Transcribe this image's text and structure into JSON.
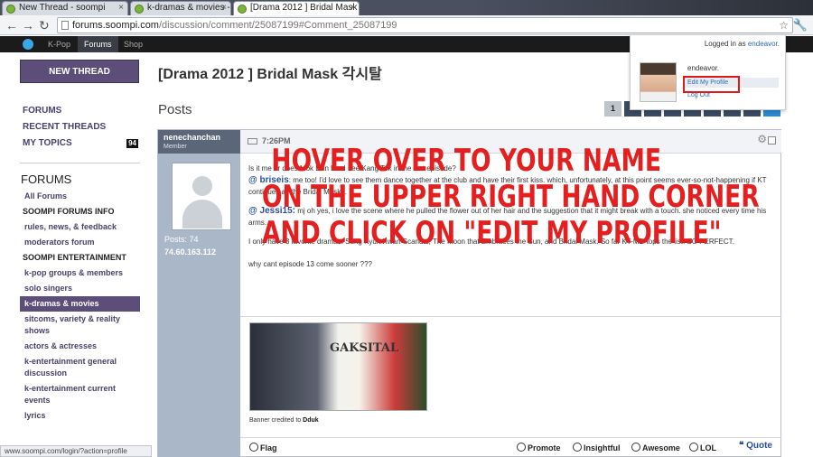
{
  "browser": {
    "tabs": [
      {
        "title": "New Thread - soompi",
        "active": false
      },
      {
        "title": "k-dramas & movies - soom",
        "active": false
      },
      {
        "title": "[Drama 2012 ] Bridal Mask",
        "active": true
      }
    ],
    "url_domain": "forums.soompi.com",
    "url_path": "/discussion/comment/25087199#Comment_25087199",
    "status_url": "www.soompi.com/login/?action=profile"
  },
  "site_nav": {
    "items": [
      "K-Pop",
      "Forums",
      "Shop"
    ],
    "active": "Forums"
  },
  "sidebar": {
    "new_thread": "NEW THREAD",
    "links": [
      {
        "label": "FORUMS"
      },
      {
        "label": "RECENT THREADS"
      },
      {
        "label": "MY TOPICS",
        "badge": "94"
      }
    ],
    "heading": "FORUMS",
    "items": [
      {
        "label": "All Forums",
        "style": "link"
      },
      {
        "label": "SOOMPI FORUMS INFO",
        "style": "category"
      },
      {
        "label": "rules, news, & feedback",
        "style": "sub"
      },
      {
        "label": "moderators forum",
        "style": "sub"
      },
      {
        "label": "SOOMPI ENTERTAINMENT",
        "style": "category"
      },
      {
        "label": "k-pop groups & members",
        "style": "sub"
      },
      {
        "label": "solo singers",
        "style": "sub"
      },
      {
        "label": "k-dramas & movies",
        "style": "active"
      },
      {
        "label": "sitcoms, variety & reality shows",
        "style": "sub"
      },
      {
        "label": "actors & actresses",
        "style": "sub"
      },
      {
        "label": "k-entertainment general discussion",
        "style": "sub"
      },
      {
        "label": "k-entertainment current events",
        "style": "sub"
      },
      {
        "label": "lyrics",
        "style": "sub"
      }
    ]
  },
  "thread": {
    "title": "[Drama 2012 ] Bridal Mask 각시탈",
    "posts_label": "Posts",
    "current_page": "1"
  },
  "post": {
    "username": "nenechanchan",
    "role": "Member",
    "posts_stat": "Posts: 74",
    "ip": "74.60.163.112",
    "time": "7:26PM",
    "line1": "Is it me or does Mok Dan liked Lee Kang Tok in the last episode?",
    "mention1": "@ briseis",
    "line2": ": me too! I'd love to see them dance together at the club and have their first kiss. which, unfortunately, at this point seems ever-so-not-happening if KT continues as the Bridal Mask...",
    "mention2": "@ Jessi15:",
    "line3": " mj oh yes, i love the scene where he pulled the flower out of her hair and the suggestion that it might break with a touch. she noticed every time his arms...",
    "line4": "I only have 3 favorite dramas: Sung Kyun Kwan Scandal, The Moon that Embraces the Sun, and Bridal Mask. So far KT-MD tops the list. SO PERFECT.",
    "line5": "why cant episode 13 come sooner ???",
    "banner_title": "GAKSITAL",
    "banner_credit_prefix": "Banner credited to ",
    "banner_credit_name": "Dduk",
    "actions": [
      "Flag",
      "Promote",
      "Insightful",
      "Awesome",
      "LOL",
      "Quote"
    ]
  },
  "userbox": {
    "logged_in_prefix": "Logged in as ",
    "username": "endeavor.",
    "display_name": "endeavor.",
    "edit_profile": "Edit My Profile",
    "log_out": "Log Out"
  },
  "instruction": {
    "line1": "HOVER OVER TO YOUR NAME",
    "line2": "ON THE UPPER RIGHT HAND CORNER",
    "line3": "AND CLICK ON \"EDIT MY PROFILE\"",
    "color": "#e41f1f"
  },
  "colors": {
    "sidebar_accent": "#5c4e78",
    "link": "#2a6ab0",
    "highlight_box": "#e01818"
  }
}
